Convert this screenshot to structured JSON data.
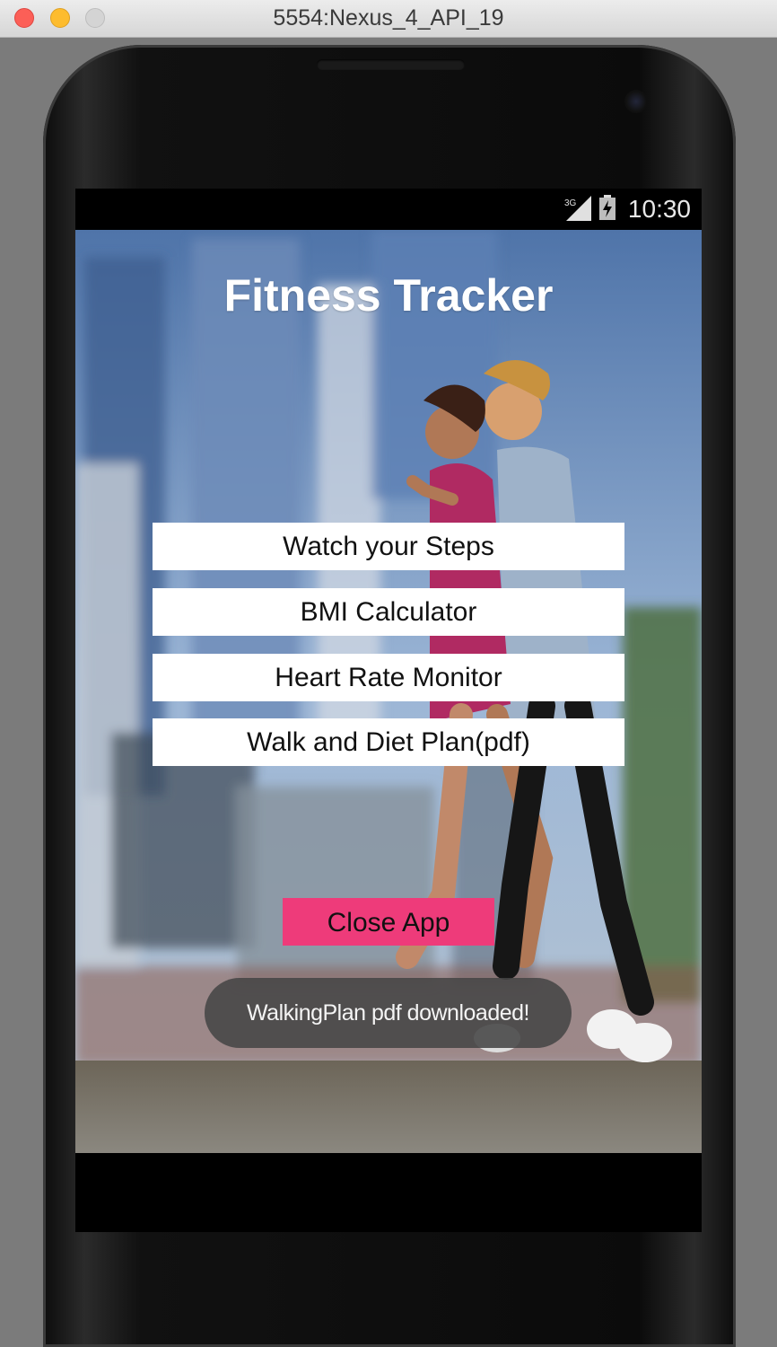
{
  "window": {
    "title": "5554:Nexus_4_API_19"
  },
  "statusbar": {
    "network": "3G",
    "time": "10:30"
  },
  "app": {
    "title": "Fitness Tracker",
    "menu": [
      {
        "label": "Watch your Steps"
      },
      {
        "label": "BMI Calculator"
      },
      {
        "label": "Heart Rate Monitor"
      },
      {
        "label": "Walk and Diet Plan(pdf)"
      }
    ],
    "close_label": "Close App",
    "toast": "WalkingPlan pdf downloaded!"
  },
  "colors": {
    "close_button": "#ee3b7a",
    "menu_button": "#ffffff",
    "title_text": "#ffffff"
  }
}
